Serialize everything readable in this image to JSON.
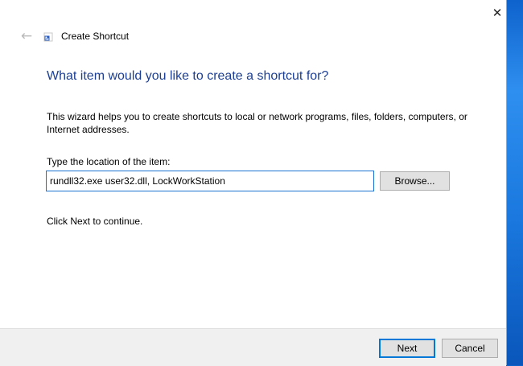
{
  "window": {
    "title": "Create Shortcut",
    "back_icon": "arrow-left-icon",
    "close_icon": "close-icon"
  },
  "page": {
    "heading": "What item would you like to create a shortcut for?",
    "intro": "This wizard helps you to create shortcuts to local or network programs, files, folders, computers, or Internet addresses.",
    "location_label": "Type the location of the item:",
    "location_value": "rundll32.exe user32.dll, LockWorkStation",
    "browse_label": "Browse...",
    "continue_text": "Click Next to continue."
  },
  "footer": {
    "next_label": "Next",
    "cancel_label": "Cancel"
  },
  "colors": {
    "heading": "#1c3f94",
    "focus_border": "#1a73d0",
    "footer_bg": "#f0f0f0",
    "desktop": "#1b7de0"
  }
}
